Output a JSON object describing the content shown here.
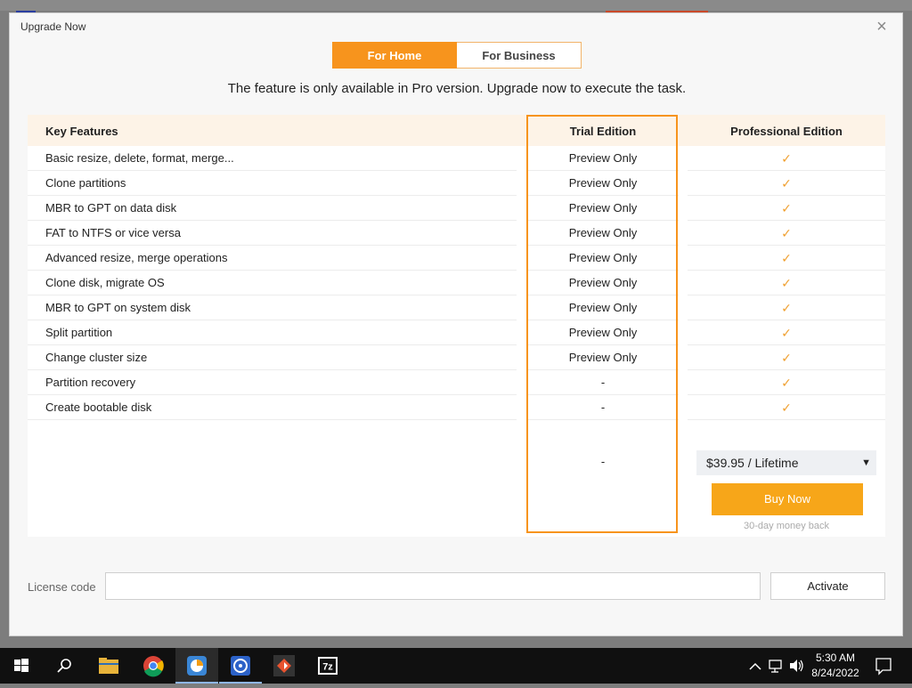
{
  "dialog": {
    "title": "Upgrade Now",
    "close_glyph": "×",
    "tabs": [
      {
        "label": "For Home",
        "active": true
      },
      {
        "label": "For Business",
        "active": false
      }
    ],
    "notice": "The feature is only available in Pro version. Upgrade now to execute the task."
  },
  "table": {
    "headers": {
      "key": "Key Features",
      "trial": "Trial Edition",
      "pro": "Professional Edition"
    },
    "rows": [
      {
        "feature": "Basic resize, delete, format, merge...",
        "trial": "Preview Only",
        "pro": "✓"
      },
      {
        "feature": "Clone partitions",
        "trial": "Preview Only",
        "pro": "✓"
      },
      {
        "feature": "MBR to GPT on data disk",
        "trial": "Preview Only",
        "pro": "✓"
      },
      {
        "feature": "FAT to NTFS or vice versa",
        "trial": "Preview Only",
        "pro": "✓"
      },
      {
        "feature": "Advanced resize, merge operations",
        "trial": "Preview Only",
        "pro": "✓"
      },
      {
        "feature": "Clone disk, migrate OS",
        "trial": "Preview Only",
        "pro": "✓"
      },
      {
        "feature": "MBR to GPT on system disk",
        "trial": "Preview Only",
        "pro": "✓"
      },
      {
        "feature": "Split partition",
        "trial": "Preview Only",
        "pro": "✓"
      },
      {
        "feature": "Change cluster size",
        "trial": "Preview Only",
        "pro": "✓"
      },
      {
        "feature": "Partition recovery",
        "trial": "-",
        "pro": "✓"
      },
      {
        "feature": "Create bootable disk",
        "trial": "-",
        "pro": "✓"
      }
    ],
    "trial_price_placeholder": "-"
  },
  "purchase": {
    "price_option": "$39.95 / Lifetime",
    "dropdown_glyph": "▼",
    "buy_label": "Buy Now",
    "money_back": "30-day money back"
  },
  "license": {
    "label": "License code",
    "value": "",
    "activate_label": "Activate"
  },
  "taskbar": {
    "time": "5:30 AM",
    "date": "8/24/2022",
    "apps": [
      "start-icon",
      "search-icon",
      "file-explorer-icon",
      "chrome-icon",
      "partition-tool-icon",
      "disk-tool-icon",
      "git-icon",
      "7zip-icon"
    ],
    "sevenzip_label": "7z"
  },
  "colors": {
    "accent": "#f7941d",
    "check": "#f0a030",
    "buy": "#f7a619"
  }
}
